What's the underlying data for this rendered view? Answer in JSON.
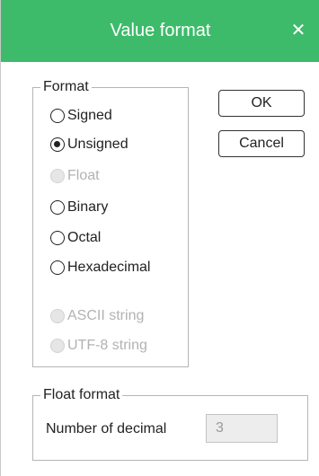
{
  "window": {
    "title": "Value format",
    "close_icon": "close-icon",
    "title_bar_color": "#3dbb6a"
  },
  "format_group": {
    "legend": "Format",
    "options": [
      {
        "label": "Signed",
        "selected": false,
        "enabled": true
      },
      {
        "label": "Unsigned",
        "selected": true,
        "enabled": true
      },
      {
        "label": "Float",
        "selected": false,
        "enabled": false
      },
      {
        "label": "Binary",
        "selected": false,
        "enabled": true
      },
      {
        "label": "Octal",
        "selected": false,
        "enabled": true
      },
      {
        "label": "Hexadecimal",
        "selected": false,
        "enabled": true
      },
      {
        "label": "ASCII string",
        "selected": false,
        "enabled": false
      },
      {
        "label": "UTF-8 string",
        "selected": false,
        "enabled": false
      }
    ]
  },
  "buttons": {
    "ok_label": "OK",
    "cancel_label": "Cancel"
  },
  "float_group": {
    "legend": "Float format",
    "decimal_label": "Number of decimal",
    "decimal_value": "3",
    "decimal_enabled": false
  }
}
